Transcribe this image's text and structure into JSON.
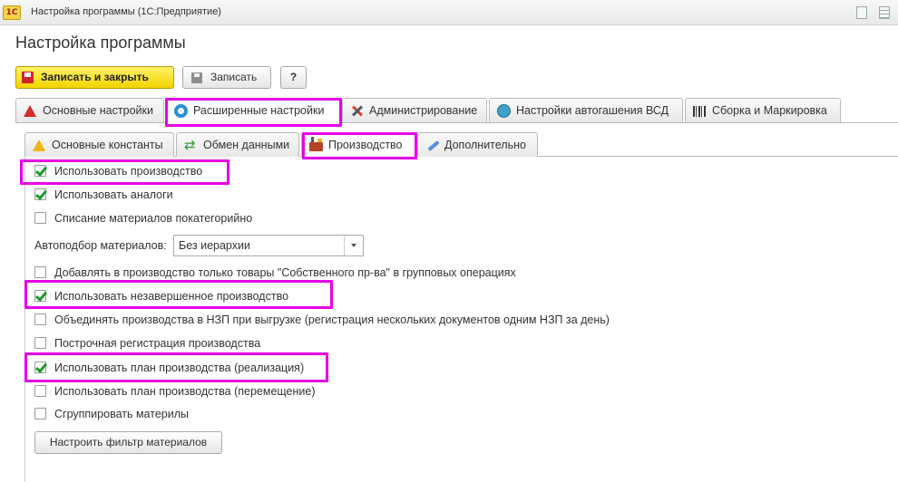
{
  "window": {
    "title": "Настройка программы  (1С:Предприятие)",
    "logo_text": "1С"
  },
  "page_title": "Настройка программы",
  "toolbar": {
    "save_close_label": "Записать и закрыть",
    "save_label": "Записать",
    "help_label": "?"
  },
  "tabs_main": [
    {
      "label": "Основные настройки",
      "icon": "warning-red-icon"
    },
    {
      "label": "Расширенные настройки",
      "icon": "gear-icon",
      "active": true
    },
    {
      "label": "Администрирование",
      "icon": "tools-icon"
    },
    {
      "label": "Настройки автогашения ВСД",
      "icon": "vsd-icon"
    },
    {
      "label": "Сборка и Маркировка",
      "icon": "barcode-icon"
    }
  ],
  "tabs_sub": [
    {
      "label": "Основные константы",
      "icon": "warning-yellow-icon"
    },
    {
      "label": "Обмен данными",
      "icon": "exchange-icon"
    },
    {
      "label": "Производство",
      "icon": "factory-icon",
      "active": true
    },
    {
      "label": "Дополнительно",
      "icon": "wrench-icon"
    }
  ],
  "settings": [
    {
      "label": "Использовать производство",
      "checked": true
    },
    {
      "label": "Использовать аналоги",
      "checked": true
    },
    {
      "label": "Списание материалов покатегорийно",
      "checked": false
    },
    {
      "label": "Добавлять в производство только товары  \"Собственного пр-ва\" в групповых операциях",
      "checked": false
    },
    {
      "label": "Использовать незавершенное производство",
      "checked": true
    },
    {
      "label": "Объединять производства в НЗП при выгрузке (регистрация нескольких документов одним НЗП за день)",
      "checked": false
    },
    {
      "label": "Построчная регистрация производства",
      "checked": false
    },
    {
      "label": "Использовать план производства (реализация)",
      "checked": true
    },
    {
      "label": "Использовать план производства (перемещение)",
      "checked": false
    },
    {
      "label": "Сгруппировать материлы",
      "checked": false
    }
  ],
  "autoselect": {
    "label": "Автоподбор материалов:",
    "value": "Без иерархии"
  },
  "filter_button_label": "Настроить фильтр материалов",
  "colors": {
    "highlight": "#e600e6",
    "primary_button": "#f3d400",
    "check": "#1e9a2a"
  }
}
